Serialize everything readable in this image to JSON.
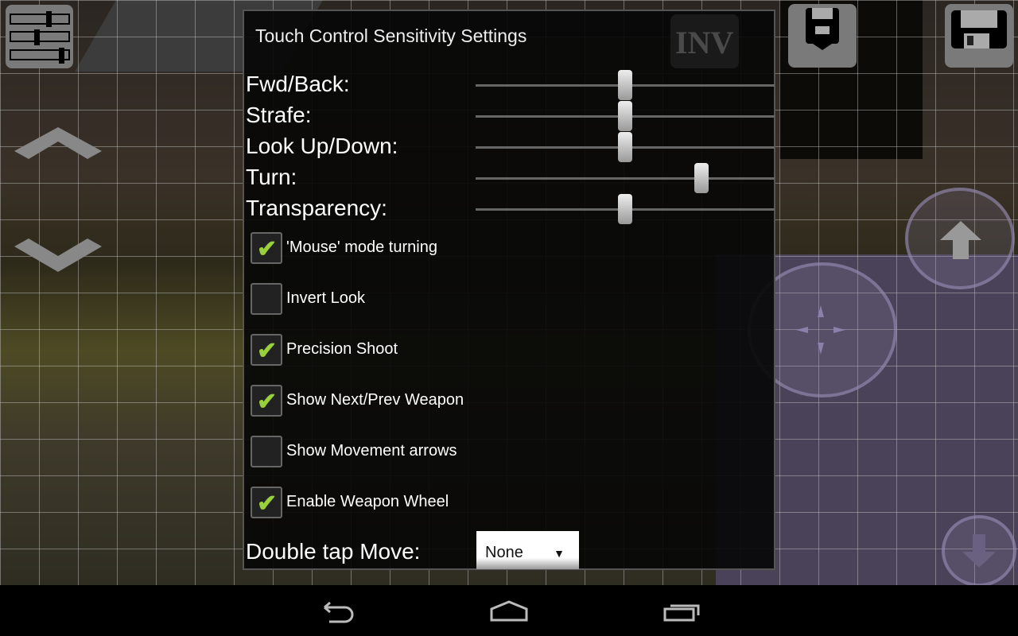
{
  "dialog": {
    "title": "Touch Control Sensitivity Settings",
    "sliders": [
      {
        "label": "Fwd/Back:",
        "value": 0.5
      },
      {
        "label": "Strafe:",
        "value": 0.5
      },
      {
        "label": "Look Up/Down:",
        "value": 0.5
      },
      {
        "label": "Turn:",
        "value": 0.755
      },
      {
        "label": "Transparency:",
        "value": 0.5
      }
    ],
    "checkboxes": [
      {
        "label": "'Mouse' mode turning",
        "checked": true
      },
      {
        "label": "Invert Look",
        "checked": false
      },
      {
        "label": "Precision Shoot",
        "checked": true
      },
      {
        "label": "Show Next/Prev Weapon",
        "checked": true
      },
      {
        "label": "Show Movement arrows",
        "checked": false
      },
      {
        "label": "Enable Weapon Wheel",
        "checked": true
      }
    ],
    "double_tap": {
      "label": "Double tap Move:",
      "value": "None"
    }
  },
  "hud": {
    "inv_label": "INV"
  },
  "colors": {
    "check": "#9ad03c",
    "dialog_bg": "#080808"
  }
}
